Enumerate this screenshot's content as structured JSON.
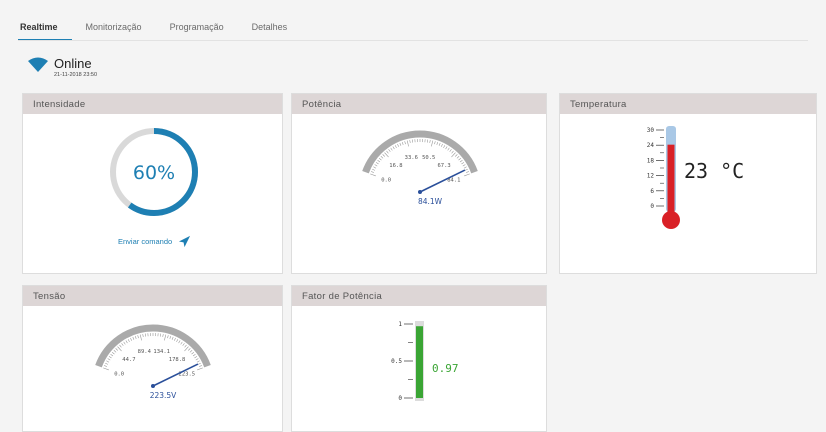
{
  "tabs": [
    "Realtime",
    "Monitorização",
    "Programação",
    "Detalhes"
  ],
  "status": {
    "state": "Online",
    "timestamp": "21-11-2018 23:50"
  },
  "cards": {
    "intensidade": {
      "title": "Intensidade",
      "value": "60%",
      "level": 0.6,
      "send_label": "Enviar comando"
    },
    "potencia": {
      "title": "Potência",
      "value": "84.1W",
      "ticks": [
        "0.0",
        "16.8",
        "33.6",
        "50.5",
        "67.3",
        "84.1"
      ]
    },
    "temperatura": {
      "title": "Temperatura",
      "value": "23 °C",
      "scale": [
        "30",
        "24",
        "18",
        "12",
        "6",
        "0"
      ],
      "level_c": 23
    },
    "tensao": {
      "title": "Tensão",
      "value": "223.5V",
      "ticks": [
        "0.0",
        "44.7",
        "89.4",
        "134.1",
        "178.8",
        "223.5"
      ]
    },
    "fator": {
      "title": "Fator de Potência",
      "value": "0.97",
      "scale": [
        "1",
        "0.5",
        "0"
      ],
      "level": 0.97
    }
  },
  "colors": {
    "accent": "#1e7fb3",
    "gauge": "#aaaaaa",
    "needle": "#2a4f9a",
    "thermo": "#d92026",
    "bar": "#3aa534",
    "header": "#ddd6d6"
  },
  "icons": {
    "status": "wifi-icon",
    "send": "send-icon"
  }
}
